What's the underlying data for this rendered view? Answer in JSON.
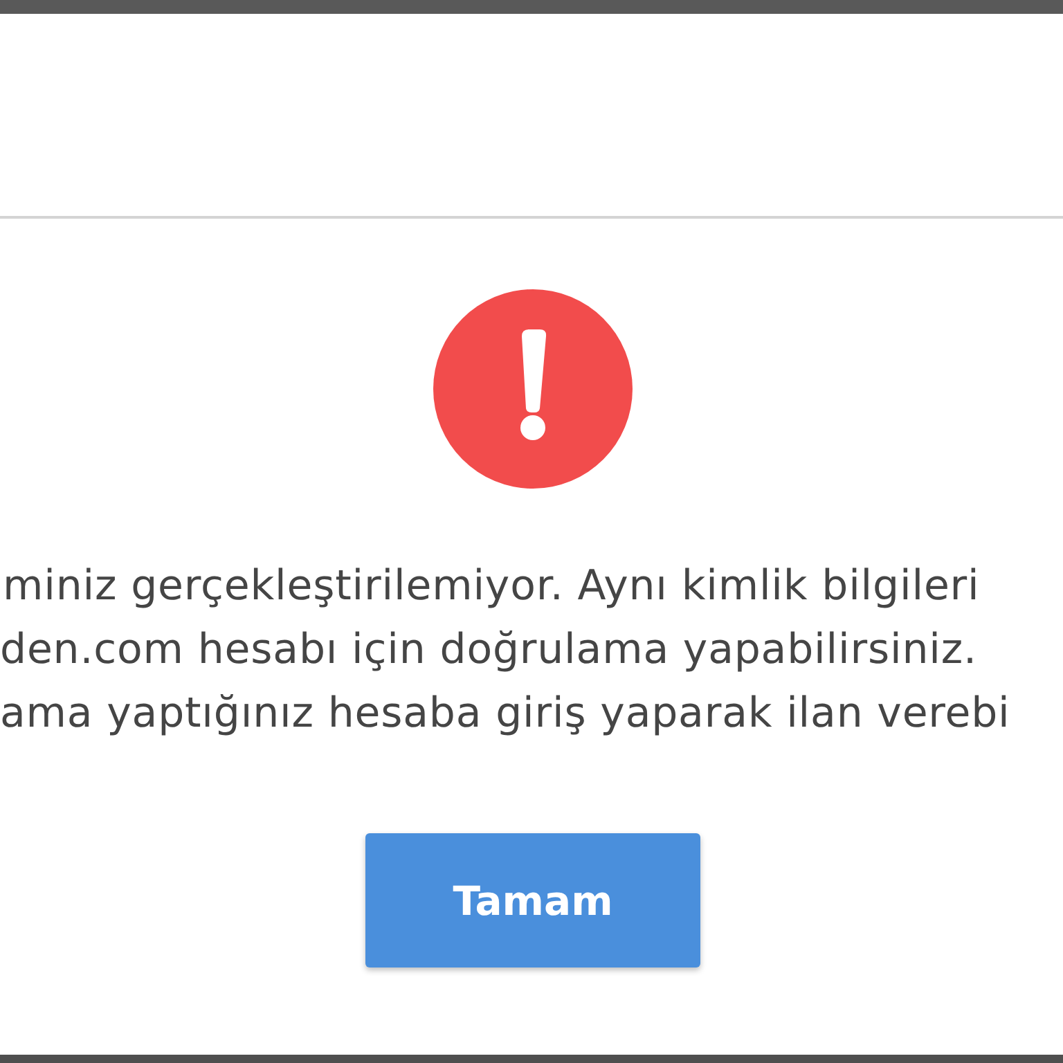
{
  "dialog": {
    "alert": {
      "kind": "error"
    },
    "message_lines": [
      "miniz gerçekleştirilemiyor. Aynı kimlik bilgileri",
      "den.com hesabı için doğrulama yapabilirsiniz.",
      "ama yaptığınız hesaba giriş yaparak ilan verebi"
    ],
    "buttons": [
      {
        "label": "Tamam",
        "kind": "primary"
      }
    ]
  }
}
